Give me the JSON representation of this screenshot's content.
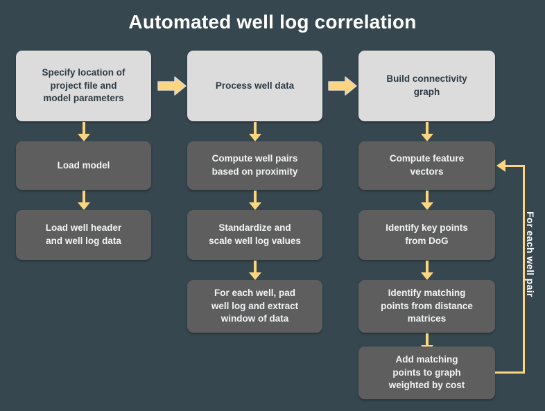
{
  "title": "Automated well log correlation",
  "colors": {
    "background": "#37474f",
    "stage_box_fill": "#dcdcdc",
    "stage_box_text": "#2e3b44",
    "step_box_fill": "#5e5e5e",
    "step_box_text": "#f2f4f5",
    "arrow": "#fcd57e",
    "title_text": "#ffffff"
  },
  "columns": [
    {
      "stage": "Specify location of\nproject file and\nmodel parameters",
      "steps": [
        "Load model",
        "Load well header\nand well log data"
      ]
    },
    {
      "stage": "Process well data",
      "steps": [
        "Compute well pairs\nbased on proximity",
        "Standardize and\nscale well log values",
        "For each well, pad\nwell log and extract\nwindow of data"
      ]
    },
    {
      "stage": "Build connectivity\ngraph",
      "steps": [
        "Compute feature\nvectors",
        "Identify key points\nfrom DoG",
        "Identify matching\npoints from distance\nmatrices",
        "Add matching\npoints to graph\nweighted by cost"
      ]
    }
  ],
  "stage_connectors": [
    {
      "name": "stage-arrow-1-to-2"
    },
    {
      "name": "stage-arrow-2-to-3"
    }
  ],
  "feedback_loop": {
    "label": "For each well pair",
    "from": "Add matching points to graph weighted by cost",
    "to": "Compute feature vectors"
  }
}
